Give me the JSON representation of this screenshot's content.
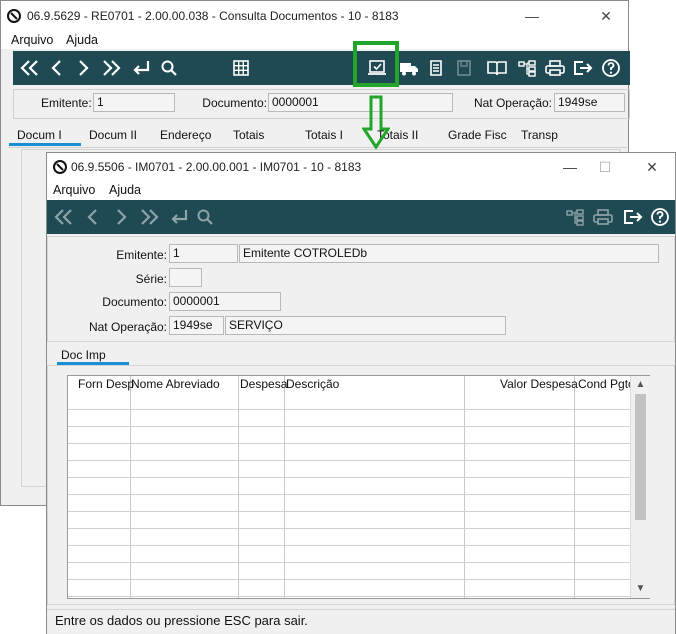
{
  "back_window": {
    "title": "06.9.5629 - RE0701 - 2.00.00.038 - Consulta Documentos - 10 - 8183",
    "menu": [
      "Arquivo",
      "Ajuda"
    ],
    "fields": {
      "emitente": {
        "label": "Emitente:",
        "value": "1"
      },
      "documento": {
        "label": "Documento:",
        "value": "0000001"
      },
      "nat_operacao": {
        "label": "Nat Operação:",
        "value": "1949se"
      }
    },
    "tabs": [
      "Docum I",
      "Docum II",
      "Endereço",
      "Totais",
      "Totais I",
      "Totais II",
      "Grade Fisc",
      "Transp"
    ],
    "active_tab": "Docum I"
  },
  "annotation": {
    "color": "#22a52a"
  },
  "front_window": {
    "title": "06.9.5506 - IM0701 - 2.00.00.001 - IM0701 - 10 - 8183",
    "menu": [
      "Arquivo",
      "Ajuda"
    ],
    "fields": {
      "emitente": {
        "label": "Emitente:",
        "value": "1",
        "name": "Emitente COTROLEDb"
      },
      "serie": {
        "label": "Série:",
        "value": ""
      },
      "documento": {
        "label": "Documento:",
        "value": "0000001"
      },
      "nat_operacao": {
        "label": "Nat Operação:",
        "value": "1949se",
        "description": "SERVIÇO"
      }
    },
    "tab": "Doc Imp",
    "grid": {
      "columns": [
        "Forn Desp",
        "Nome Abreviado",
        "Despesa",
        "Descrição",
        "Valor Despesa",
        "Cond Pgto"
      ],
      "rows": []
    },
    "status": "Entre os dados ou pressione ESC para sair."
  },
  "colors": {
    "toolbar": "#1f4a54",
    "tab_underline": "#1a8fd6",
    "annotation": "#22a52a"
  }
}
